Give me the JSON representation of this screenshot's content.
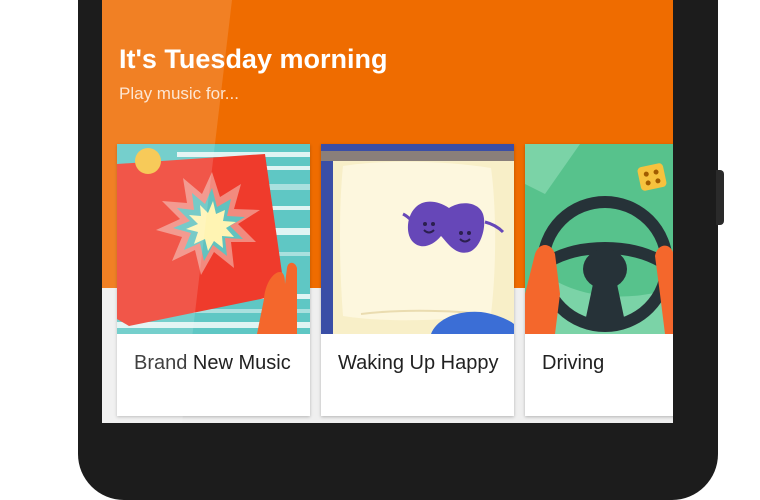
{
  "header": {
    "title": "It's Tuesday morning",
    "subtitle": "Play music for..."
  },
  "cards": [
    {
      "label": "Brand New Music",
      "art_icon": "starburst-record-icon"
    },
    {
      "label": "Waking Up Happy",
      "art_icon": "sleep-mask-icon"
    },
    {
      "label": "Driving",
      "art_icon": "steering-wheel-icon"
    }
  ],
  "colors": {
    "header_orange": "#ef6c00",
    "card_background": "#ffffff",
    "screen_background": "#efefef"
  }
}
